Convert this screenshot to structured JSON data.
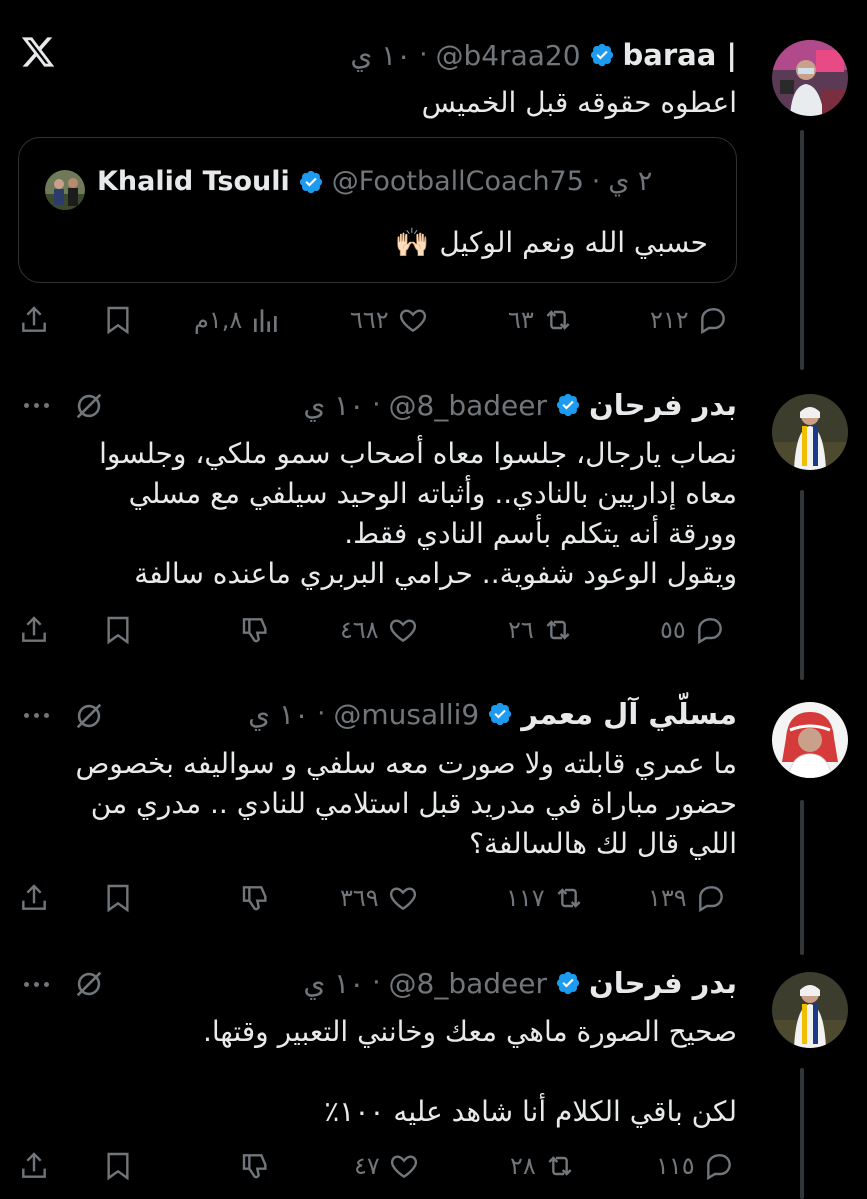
{
  "tweets": [
    {
      "name": "baraa |",
      "handle": "@b4raa20",
      "time": "١٠ ي",
      "text": "اعطوه حقوقه قبل الخميس",
      "quote": {
        "name": "Khalid Tsouli",
        "handle": "@FootballCoach75",
        "time": "٢ ي",
        "text": "حسبي الله ونعم الوكيل",
        "emoji": "🙌🏻"
      },
      "stats": {
        "replies": "٢١٢",
        "reposts": "٦٣",
        "likes": "٦٦٢",
        "views": "١,٨م"
      }
    },
    {
      "name": "بدر فرحان",
      "handle": "@8_badeer",
      "time": "١٠ ي",
      "text": "نصاب يارجال، جلسوا معاه أصحاب سمو ملكي، وجلسوا\nمعاه إداريين بالنادي.. وأثباته الوحيد سيلفي مع مسلي\nوورقة أنه يتكلم بأسم النادي فقط.\nويقول الوعود شفوية.. حرامي البربري ماعنده سالفة",
      "stats": {
        "replies": "٥٥",
        "reposts": "٢٦",
        "likes": "٤٦٨"
      }
    },
    {
      "name": "مسلّي آل معمر",
      "handle": "@musalli9",
      "time": "١٠ ي",
      "text": "ما عمري قابلته ولا صورت معه سلفي و سواليفه بخصوص\nحضور مباراة في مدريد قبل استلامي للنادي .. مدري من\nاللي قال لك هالسالفة؟",
      "stats": {
        "replies": "١٣٩",
        "reposts": "١١٧",
        "likes": "٣٦٩"
      }
    },
    {
      "name": "بدر فرحان",
      "handle": "@8_badeer",
      "time": "١٠ ي",
      "text": "صحيح الصورة ماهي معك وخانني التعبير وقتها.\n\nلكن باقي الكلام أنا شاهد عليه ١٠٠٪",
      "stats": {
        "replies": "١١٥",
        "reposts": "٢٨",
        "likes": "٤٧"
      }
    }
  ],
  "colors": {
    "background": "#000000",
    "text": "#e7e9ea",
    "muted": "#71767b",
    "verified": "#1d9bf0",
    "line": "#333639"
  },
  "icons": [
    "x-logo-icon",
    "verified-icon",
    "more-icon",
    "mute-icon",
    "reply-icon",
    "repost-icon",
    "like-icon",
    "views-icon",
    "bookmark-icon",
    "share-icon",
    "hand-dislike-icon"
  ]
}
